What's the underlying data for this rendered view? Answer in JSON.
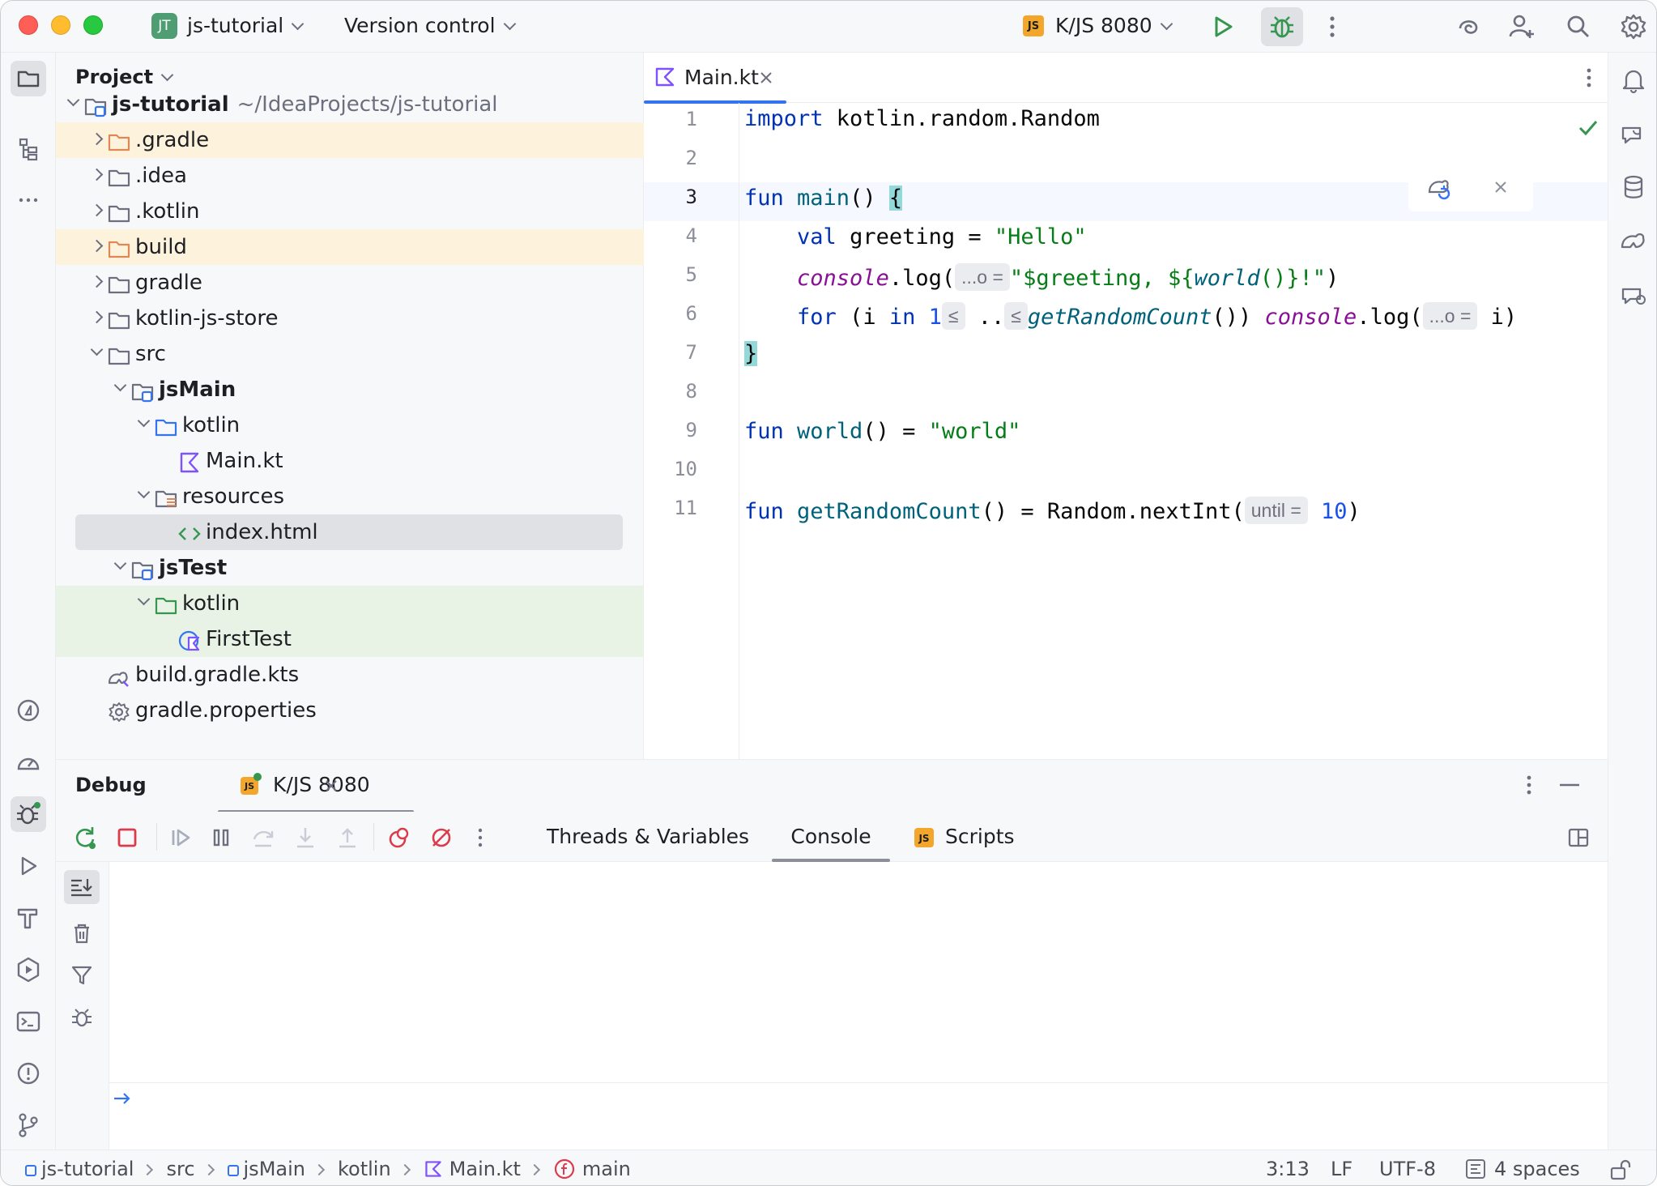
{
  "titlebar": {
    "project_badge": "JT",
    "project_name": "js-tutorial",
    "vcs_label": "Version control",
    "run_config_badge": "JS",
    "run_config": "K/JS 8080",
    "icons": [
      "run-icon",
      "debug-icon",
      "more-icon",
      "ai-assistant-icon",
      "add-user-icon",
      "search-icon",
      "settings-icon"
    ]
  },
  "project_panel": {
    "title": "Project",
    "tree": [
      {
        "label": "js-tutorial",
        "path": "~/IdeaProjects/js-tutorial",
        "bold": true,
        "icon": "module-folder-icon",
        "indent": 0,
        "expanded": true,
        "bg": "none"
      },
      {
        "label": ".gradle",
        "icon": "excluded-folder-icon",
        "indent": 1,
        "expanded": false,
        "bg": "yellow"
      },
      {
        "label": ".idea",
        "icon": "folder-icon",
        "indent": 1,
        "expanded": false,
        "bg": "none"
      },
      {
        "label": ".kotlin",
        "icon": "folder-icon",
        "indent": 1,
        "expanded": false,
        "bg": "none"
      },
      {
        "label": "build",
        "icon": "excluded-folder-icon",
        "indent": 1,
        "expanded": false,
        "bg": "yellow"
      },
      {
        "label": "gradle",
        "icon": "folder-icon",
        "indent": 1,
        "expanded": false,
        "bg": "none"
      },
      {
        "label": "kotlin-js-store",
        "icon": "folder-icon",
        "indent": 1,
        "expanded": false,
        "bg": "none"
      },
      {
        "label": "src",
        "icon": "folder-icon",
        "indent": 1,
        "expanded": true,
        "bg": "none"
      },
      {
        "label": "jsMain",
        "bold": true,
        "icon": "module-folder-icon",
        "indent": 2,
        "expanded": true,
        "bg": "none"
      },
      {
        "label": "kotlin",
        "icon": "source-folder-icon",
        "indent": 3,
        "expanded": true,
        "bg": "none"
      },
      {
        "label": "Main.kt",
        "icon": "kotlin-file-icon",
        "indent": 4,
        "leaf": true,
        "bg": "none"
      },
      {
        "label": "resources",
        "icon": "resources-folder-icon",
        "indent": 3,
        "expanded": true,
        "bg": "none"
      },
      {
        "label": "index.html",
        "icon": "html-file-icon",
        "indent": 4,
        "leaf": true,
        "bg": "selected"
      },
      {
        "label": "jsTest",
        "bold": true,
        "icon": "module-folder-icon",
        "indent": 2,
        "expanded": true,
        "bg": "none"
      },
      {
        "label": "kotlin",
        "icon": "test-folder-icon",
        "indent": 3,
        "expanded": true,
        "bg": "green"
      },
      {
        "label": "FirstTest",
        "icon": "kotlin-test-icon",
        "indent": 4,
        "leaf": true,
        "bg": "green"
      },
      {
        "label": "build.gradle.kts",
        "icon": "gradle-file-icon",
        "indent": 1,
        "leaf": true,
        "bg": "none"
      },
      {
        "label": "gradle.properties",
        "icon": "settings-file-icon",
        "indent": 1,
        "leaf": true,
        "bg": "none"
      }
    ]
  },
  "editor": {
    "tab_label": "Main.kt",
    "line_numbers": [
      "1",
      "2",
      "3",
      "4",
      "5",
      "6",
      "7",
      "8",
      "9",
      "10",
      "11"
    ],
    "current_line": 3,
    "code": {
      "l1": {
        "kw": "import",
        "rest": " kotlin.random.Random"
      },
      "l3": {
        "kw": "fun",
        "fn": " main",
        "rest": "() ",
        "brace": "{"
      },
      "l4": {
        "kw": "val",
        "rest": " greeting = ",
        "str": "\"Hello\""
      },
      "l5": {
        "obj": "console",
        "rest": ".log(",
        "hint": "...o =",
        "str1": "\"$greeting, ${",
        "call": "world",
        "str2": "()}!\"",
        "close": ")"
      },
      "l6": {
        "kw": "for",
        "open": " (i ",
        "in": "in",
        "num": " 1",
        "hint1": "≤",
        "dots": " ..",
        "hint2": "≤",
        "call": "getRandomCount",
        "mid": "()) ",
        "obj": "console",
        "log": ".log(",
        "hint3": "...o =",
        "tail": " i)"
      },
      "l7": {
        "brace": "}"
      },
      "l9": {
        "kw": "fun",
        "fn": " world",
        "rest": "() = ",
        "str": "\"world\""
      },
      "l11": {
        "kw": "fun",
        "fn": " getRandomCount",
        "rest": "() = Random.nextInt(",
        "hint": "until =",
        "num": " 10",
        "close": ")"
      }
    }
  },
  "debug_panel": {
    "title": "Debug",
    "session_badge": "JS",
    "session_label": "K/JS 8080",
    "tabs": [
      {
        "label": "Threads & Variables",
        "active": false
      },
      {
        "label": "Console",
        "active": true
      },
      {
        "label": "Scripts",
        "active": false,
        "badge": "JS"
      }
    ]
  },
  "statusbar": {
    "breadcrumb": [
      "js-tutorial",
      "src",
      "jsMain",
      "kotlin",
      "Main.kt",
      "main"
    ],
    "position": "3:13",
    "line_ending": "LF",
    "encoding": "UTF-8",
    "indent": "4 spaces"
  },
  "colors": {
    "accent": "#3574f0",
    "excluded_bg": "#fdf3dd",
    "test_bg": "#e8f3e6",
    "keyword": "#0033b3",
    "string": "#067d17",
    "function": "#00627a"
  }
}
